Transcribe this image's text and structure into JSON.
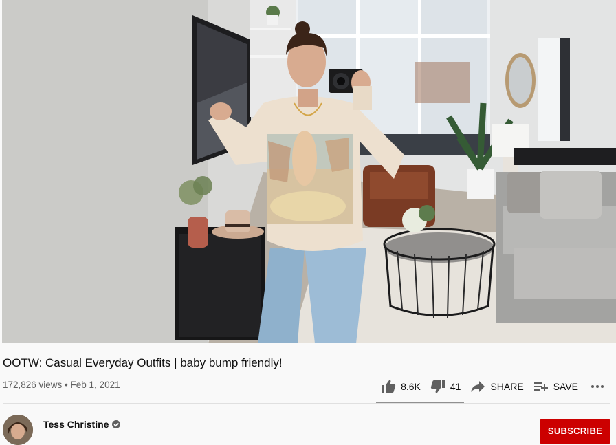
{
  "video": {
    "title": "OOTW: Casual Everyday Outfits | baby bump friendly!",
    "meta": "172,826 views • Feb 1, 2021"
  },
  "actions": {
    "like_count": "8.6K",
    "dislike_count": "41",
    "share_label": "SHARE",
    "save_label": "SAVE",
    "like_ratio": 0.995
  },
  "channel": {
    "name": "Tess Christine",
    "subscribe_label": "SUBSCRIBE"
  },
  "colors": {
    "subscribe_bg": "#cc0000",
    "page_bg": "#f9f9f9"
  },
  "icons": [
    "thumbs-up-icon",
    "thumbs-down-icon",
    "share-arrow-icon",
    "playlist-add-icon",
    "more-icon",
    "verified-check-icon"
  ]
}
